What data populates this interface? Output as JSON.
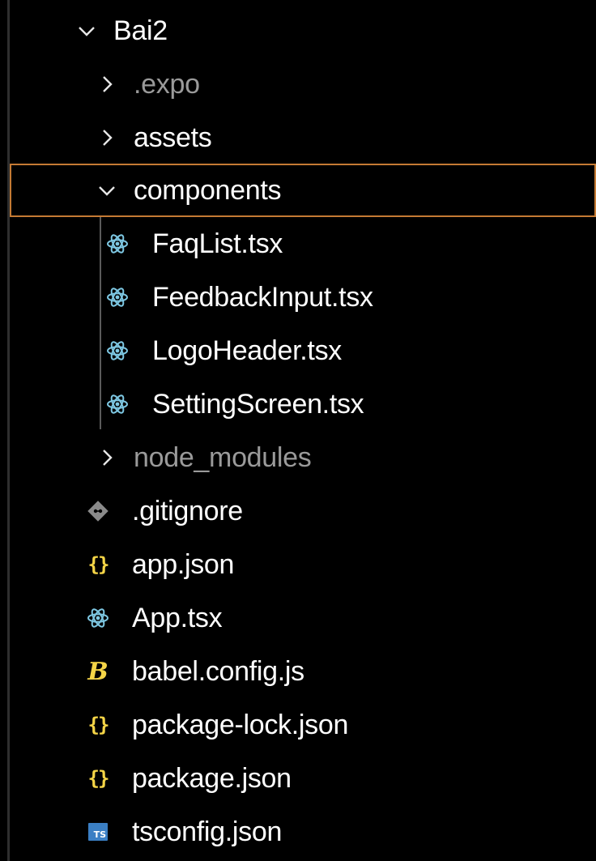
{
  "explorer": {
    "accent_selected_border": "#c47a34",
    "rows": [
      {
        "label": "Bai2",
        "kind": "folder",
        "expanded": true,
        "icon": "chevron-down-icon"
      },
      {
        "label": ".expo",
        "kind": "folder",
        "expanded": false,
        "dimmed": true,
        "icon": "chevron-right-icon"
      },
      {
        "label": "assets",
        "kind": "folder",
        "expanded": false,
        "icon": "chevron-right-icon"
      },
      {
        "label": "components",
        "kind": "folder",
        "expanded": true,
        "selected": true,
        "icon": "chevron-down-icon"
      },
      {
        "label": "FaqList.tsx",
        "kind": "file",
        "icon": "react-icon"
      },
      {
        "label": "FeedbackInput.tsx",
        "kind": "file",
        "icon": "react-icon"
      },
      {
        "label": "LogoHeader.tsx",
        "kind": "file",
        "icon": "react-icon"
      },
      {
        "label": "SettingScreen.tsx",
        "kind": "file",
        "icon": "react-icon"
      },
      {
        "label": "node_modules",
        "kind": "folder",
        "expanded": false,
        "dimmed": true,
        "icon": "chevron-right-icon"
      },
      {
        "label": ".gitignore",
        "kind": "file",
        "icon": "git-icon"
      },
      {
        "label": "app.json",
        "kind": "file",
        "icon": "json-icon"
      },
      {
        "label": "App.tsx",
        "kind": "file",
        "icon": "react-icon"
      },
      {
        "label": "babel.config.js",
        "kind": "file",
        "icon": "babel-icon"
      },
      {
        "label": "package-lock.json",
        "kind": "file",
        "icon": "json-icon"
      },
      {
        "label": "package.json",
        "kind": "file",
        "icon": "json-icon"
      },
      {
        "label": "tsconfig.json",
        "kind": "file",
        "icon": "typescript-icon"
      }
    ],
    "icon_glyphs": {
      "json": "{}",
      "babel": "B",
      "typescript": "TS"
    }
  }
}
